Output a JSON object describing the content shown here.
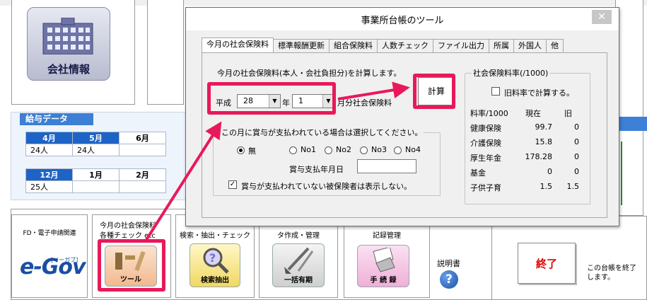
{
  "company_info": {
    "label": "会社情報"
  },
  "salary_data": {
    "title": "給与データ",
    "rows": [
      {
        "months": [
          "4月",
          "5月",
          "6月"
        ],
        "counts": [
          "24人",
          "24人",
          ""
        ]
      },
      {
        "months": [
          "12月",
          "1月",
          "2月"
        ],
        "counts": [
          "25人",
          "",
          ""
        ]
      }
    ]
  },
  "bottom": {
    "fd_label": "FD・電子申請関連",
    "egov_text": "e-Gov",
    "egov_sub": "[イーガブ]",
    "tool_caption_1": "今月の社会保険料",
    "tool_caption_2": "各種チェック etc",
    "tool_label": "ツール",
    "search_caption": "検索・抽出・チェック",
    "search_label": "検索抽出",
    "bulk_caption": "タ作成・管理",
    "bulk_label": "一括有期",
    "records_caption": "記録管理",
    "records_label": "手 続 録",
    "manual_label": "説明書",
    "help_glyph": "?",
    "exit_label": "終了",
    "exit_desc": "この台帳を終了します。"
  },
  "dialog": {
    "title": "事業所台帳のツール",
    "close_glyph": "✕",
    "tabs": [
      "今月の社会保険料",
      "標準報酬更新",
      "組合保険料",
      "人数チェック",
      "ファイル出力",
      "所属",
      "外国人",
      "他"
    ],
    "active_tab": 0,
    "description": "今月の社会保険料(本人・会社負担分)を計算します。",
    "era_label": "平成",
    "year_value": "28",
    "year_unit": "年",
    "month_value": "1",
    "month_suffix": "月分社会保険料",
    "calc_button": "計算",
    "bonus_group": {
      "title": "この月に賞与が支払われている場合は選択してください。",
      "options": [
        "無",
        "No1",
        "No2",
        "No3",
        "No4"
      ],
      "selected": "無",
      "date_label": "賞与支払年月日",
      "date_value": "",
      "hide_label": "賞与が支払われていない被保険者は表示しない。",
      "hide_checked": true
    },
    "rate_group": {
      "title": "社会保険料率(/1000)",
      "old_rate_label": "旧料率で計算する。",
      "old_rate_checked": false,
      "headers": [
        "料率/1000",
        "現在",
        "旧"
      ],
      "rows": [
        {
          "name": "健康保険",
          "current": "99.7",
          "old": "0"
        },
        {
          "name": "介護保険",
          "current": "15.8",
          "old": "0"
        },
        {
          "name": "厚生年金",
          "current": "178.28",
          "old": "0"
        },
        {
          "name": "基金",
          "current": "0",
          "old": "0"
        },
        {
          "name": "子供子育",
          "current": "1.5",
          "old": "1.5"
        }
      ]
    }
  },
  "colors": {
    "highlight": "#e8195a",
    "header_blue": "#1e63c6",
    "exit_red": "#e00000"
  }
}
